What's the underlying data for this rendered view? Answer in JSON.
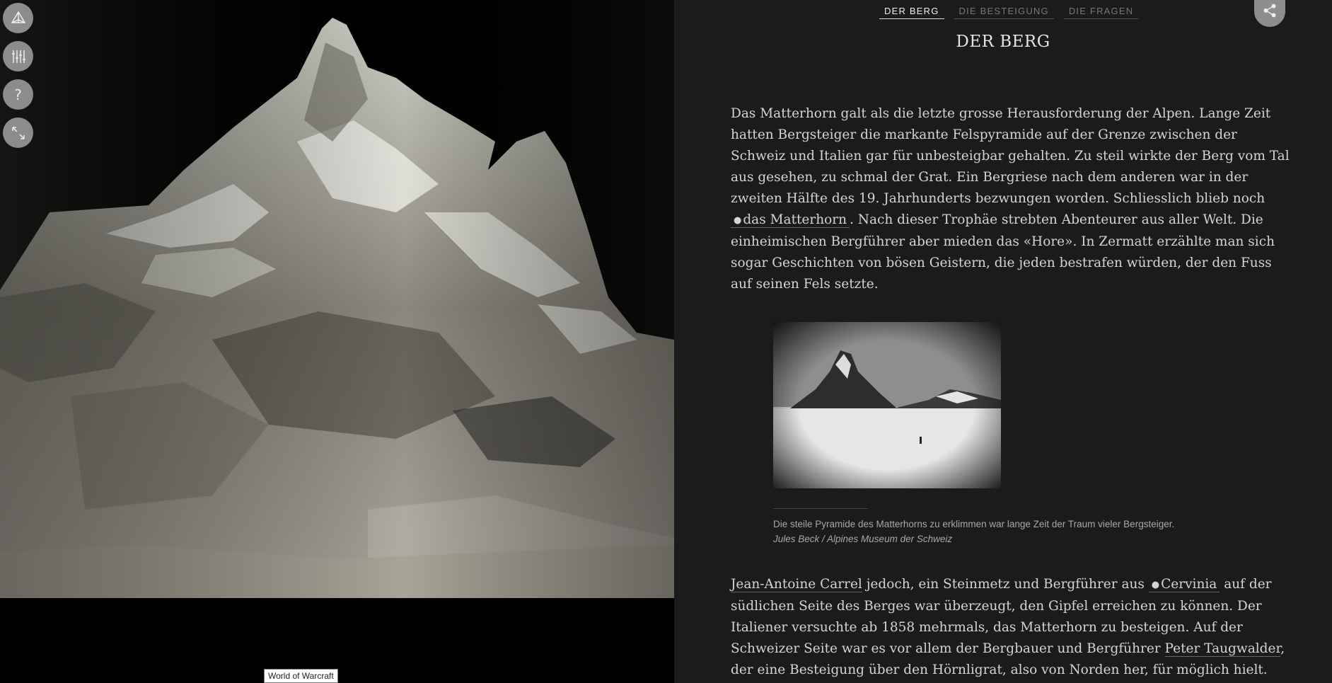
{
  "viewer": {
    "tooltip": "World of Warcraft",
    "tools": [
      {
        "name": "3d-view-icon"
      },
      {
        "name": "settings-sliders-icon"
      },
      {
        "name": "help-icon",
        "glyph": "?"
      },
      {
        "name": "fullscreen-icon"
      }
    ]
  },
  "nav": {
    "tabs": [
      {
        "label": "DER BERG",
        "active": true
      },
      {
        "label": "DIE BESTEIGUNG",
        "active": false
      },
      {
        "label": "DIE FRAGEN",
        "active": false
      }
    ]
  },
  "article": {
    "heading": "DER BERG",
    "p1_a": "Das Matterhorn galt als die letzte grosse Herausforderung der Alpen. Lange Zeit hatten Bergsteiger die markante Felspyramide auf der Grenze zwischen der Schweiz und Italien gar für unbesteigbar gehalten. Zu steil wirkte der Berg vom Tal aus gesehen, zu schmal der Grat. Ein Bergriese nach dem anderen war in der zweiten Hälfte des 19. Jahrhunderts bezwungen worden. Schliesslich blieb noch",
    "p1_link": "das Matterhorn",
    "p1_b": ". Nach dieser Trophäe strebten Abenteurer aus aller Welt. Die einheimischen Bergführer aber mieden das «Hore». In Zermatt erzählte man sich sogar Geschichten von bösen Geistern, die jeden bestrafen würden, der den Fuss auf seinen Fels setzte.",
    "figure_caption": "Die steile Pyramide des Matterhorns zu erklimmen war lange Zeit der Traum vieler Bergsteiger.",
    "figure_credit": "Jules Beck / Alpines Museum der Schweiz",
    "p2_link1": "Jean-Antoine Carrel",
    "p2_a": " jedoch, ein Steinmetz und Bergführer aus ",
    "p2_link2": "Cervinia",
    "p2_b": " auf der südlichen Seite des Berges war überzeugt, den Gipfel erreichen zu können. Der Italiener versuchte ab 1858 mehrmals, das Matterhorn zu besteigen. Auf der Schweizer Seite war es vor allem der Bergbauer und Bergführer ",
    "p2_link3": "Peter Taugwalder",
    "p2_c": ", der eine Besteigung über den Hörnligrat, also von Norden her, für möglich hielt. Die Jahre von"
  }
}
